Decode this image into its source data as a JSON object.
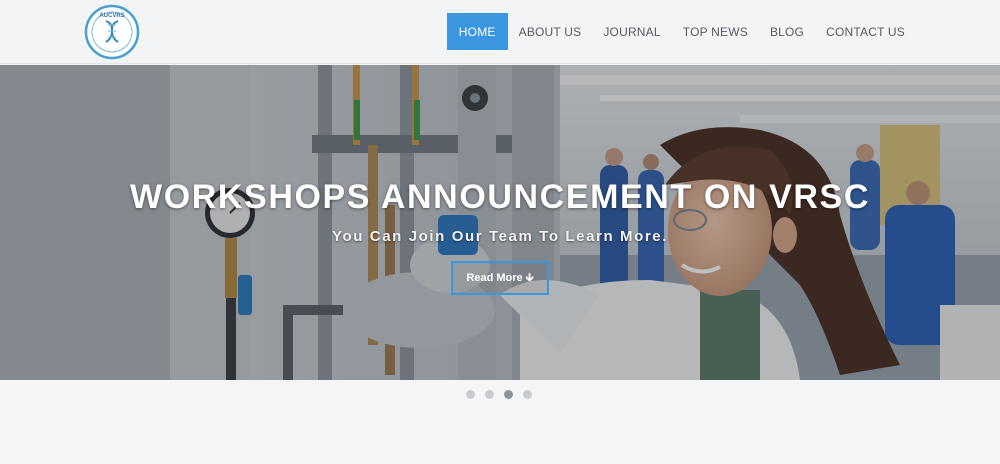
{
  "logo": {
    "text": "AUCVRS",
    "icon": "dna-helix-icon"
  },
  "nav": {
    "items": [
      {
        "label": "HOME",
        "active": true
      },
      {
        "label": "ABOUT US",
        "active": false
      },
      {
        "label": "JOURNAL",
        "active": false
      },
      {
        "label": "TOP NEWS",
        "active": false
      },
      {
        "label": "BLOG",
        "active": false
      },
      {
        "label": "CONTACT US",
        "active": false
      }
    ]
  },
  "hero": {
    "title": "WORKSHOPS ANNOUNCEMENT ON VRSC",
    "subtitle": "You Can Join Our Team To Learn More.",
    "button_label": "Read More",
    "button_icon": "arrow-down-icon"
  },
  "carousel": {
    "slide_count": 4,
    "active_index": 2
  },
  "colors": {
    "accent": "#3a97df",
    "nav_text": "#555b61",
    "logo_ring": "#4a9fd0"
  }
}
